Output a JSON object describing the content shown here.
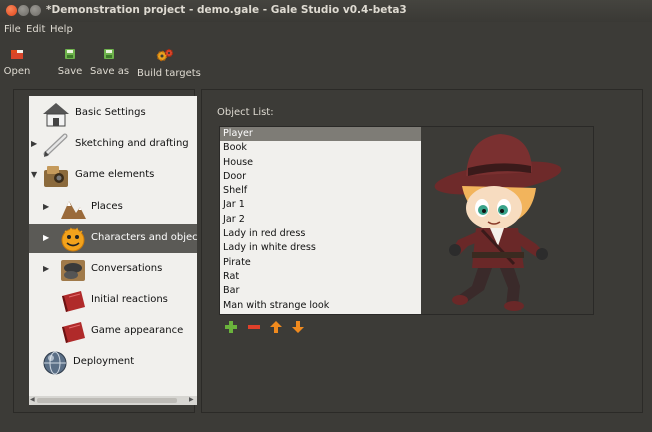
{
  "window": {
    "title": "*Demonstration project - demo.gale - Gale Studio v0.4-beta3"
  },
  "menu": [
    "File",
    "Edit",
    "Help"
  ],
  "toolbar": {
    "open": "Open",
    "save": "Save",
    "save_as": "Save as",
    "build_targets": "Build targets"
  },
  "tree": {
    "items": [
      {
        "label": "Basic Settings",
        "icon": "house-icon"
      },
      {
        "label": "Sketching and drafting",
        "icon": "pencil-icon"
      },
      {
        "label": "Game elements",
        "icon": "camera-box-icon"
      },
      {
        "label": "Places",
        "icon": "mountain-icon"
      },
      {
        "label": "Characters and objects",
        "icon": "smiley-icon"
      },
      {
        "label": "Conversations",
        "icon": "coin-icon"
      },
      {
        "label": "Initial reactions",
        "icon": "red-book-icon"
      },
      {
        "label": "Game appearance",
        "icon": "red-book-icon"
      },
      {
        "label": "Deployment",
        "icon": "globe-icon"
      }
    ]
  },
  "object_list": {
    "label": "Object List:",
    "items": [
      "Player",
      "Book",
      "House",
      "Door",
      "Shelf",
      "Jar 1",
      "Jar 2",
      "Lady in red dress",
      "Lady in white dress",
      "Pirate",
      "Rat",
      "Bar",
      "Man with strange look"
    ],
    "selected": "Player"
  },
  "actions": [
    "add-icon",
    "remove-icon",
    "move-up-icon",
    "move-down-icon"
  ]
}
